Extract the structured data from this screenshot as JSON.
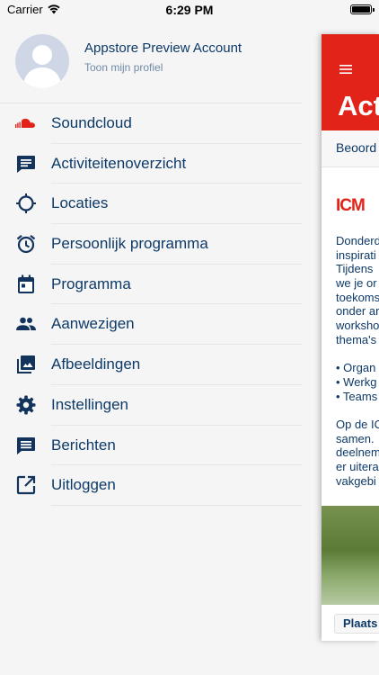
{
  "status": {
    "carrier": "Carrier",
    "time": "6:29 PM"
  },
  "profile": {
    "name": "Appstore Preview Account",
    "link": "Toon mijn profiel"
  },
  "menu": [
    {
      "label": "Soundcloud",
      "icon": "soundcloud-icon",
      "color": "#e2231a"
    },
    {
      "label": "Activiteitenoverzicht",
      "icon": "message-icon"
    },
    {
      "label": "Locaties",
      "icon": "location-crosshair-icon"
    },
    {
      "label": "Persoonlijk programma",
      "icon": "alarm-clock-icon"
    },
    {
      "label": "Programma",
      "icon": "calendar-icon"
    },
    {
      "label": "Aanwezigen",
      "icon": "people-icon"
    },
    {
      "label": "Afbeeldingen",
      "icon": "photo-library-icon"
    },
    {
      "label": "Instellingen",
      "icon": "gear-icon"
    },
    {
      "label": "Berichten",
      "icon": "chat-icon"
    },
    {
      "label": "Uitloggen",
      "icon": "open-in-new-icon"
    }
  ],
  "preview": {
    "title": "Act",
    "subbar": "Beoord",
    "logo": "ICM",
    "body_lines": [
      "Donderd",
      "inspirati",
      "Tijdens",
      "we je or",
      "toekoms",
      "onder ar",
      "worksho",
      "thema's",
      "",
      "• Organ",
      "• Werkg",
      "• Teams",
      "",
      "Op de IC",
      "samen.",
      "deelnem",
      "er uitera",
      "vakgebi"
    ],
    "footer": "Plaats"
  },
  "colors": {
    "brand_red": "#e2231a",
    "text_navy": "#0d3a68",
    "icon_navy": "#12335c"
  }
}
